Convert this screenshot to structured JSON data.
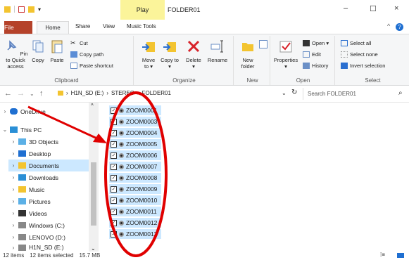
{
  "window": {
    "contextual_tab": "Play",
    "title": "FOLDER01",
    "minimize": "–",
    "maximize": "☐",
    "close": "×"
  },
  "tabs": [
    "File",
    "Home",
    "Share",
    "View",
    "Music Tools"
  ],
  "ribbon": {
    "clipboard": {
      "label": "Clipboard",
      "pin": "Pin to Quick access",
      "copy": "Copy",
      "paste": "Paste",
      "cut": "Cut",
      "copy_path": "Copy path",
      "paste_shortcut": "Paste shortcut"
    },
    "organize": {
      "label": "Organize",
      "move_to": "Move to ▾",
      "copy_to": "Copy to ▾",
      "delete": "Delete ▾",
      "rename": "Rename"
    },
    "new": {
      "label": "New",
      "new_folder": "New folder"
    },
    "open": {
      "label": "Open",
      "properties": "Properties ▾",
      "open": "Open ▾",
      "edit": "Edit",
      "history": "History"
    },
    "select": {
      "label": "Select",
      "select_all": "Select all",
      "select_none": "Select none",
      "invert_selection": "Invert selection"
    }
  },
  "address": {
    "crumbs": [
      "H1N_SD (E:)",
      "STEREO",
      "FOLDER01"
    ],
    "search_placeholder": "Search FOLDER01"
  },
  "nav": [
    {
      "label": "OneDrive",
      "indent": 0
    },
    {
      "label": "This PC",
      "indent": 0
    },
    {
      "label": "3D Objects",
      "indent": 1
    },
    {
      "label": "Desktop",
      "indent": 1
    },
    {
      "label": "Documents",
      "indent": 1
    },
    {
      "label": "Downloads",
      "indent": 1
    },
    {
      "label": "Music",
      "indent": 1
    },
    {
      "label": "Pictures",
      "indent": 1
    },
    {
      "label": "Videos",
      "indent": 1
    },
    {
      "label": "Windows (C:)",
      "indent": 1
    },
    {
      "label": "LENOVO (D:)",
      "indent": 1
    },
    {
      "label": "H1N_SD (E:)",
      "indent": 1
    }
  ],
  "files": [
    "ZOOM0001",
    "ZOOM0003",
    "ZOOM0004",
    "ZOOM0005",
    "ZOOM0006",
    "ZOOM0007",
    "ZOOM0008",
    "ZOOM0009",
    "ZOOM0010",
    "ZOOM0011",
    "ZOOM0012",
    "ZOOM0013"
  ],
  "status": {
    "count": "12 items",
    "selected": "12 items selected",
    "size": "15.7 MB"
  },
  "colors": {
    "file_tab": "#b5422a",
    "selection": "#cce8ff",
    "play_tab": "#fbf49a",
    "annotation": "#e00000"
  }
}
